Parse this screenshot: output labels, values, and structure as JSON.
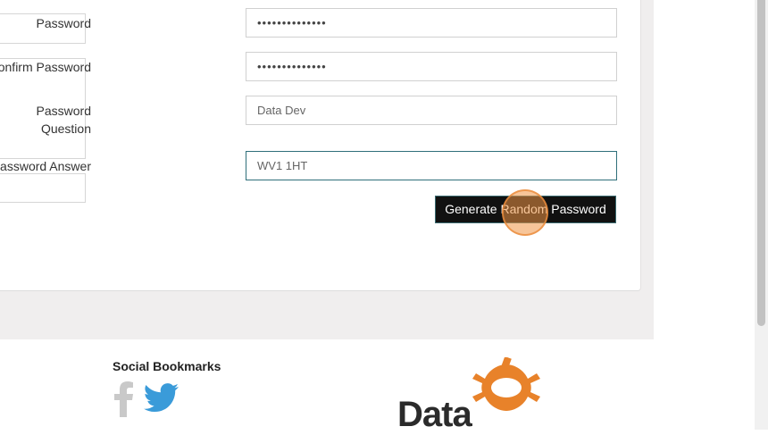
{
  "form": {
    "password": {
      "label": "Password",
      "value": "••••••••••••••"
    },
    "confirm_password": {
      "label": "Confirm Password",
      "value": "••••••••••••••"
    },
    "password_question": {
      "label": "Password Question",
      "value": "Data Dev"
    },
    "password_answer": {
      "label": "Password Answer",
      "value": "WV1 1HT"
    },
    "generate_button": "Generate Random Password"
  },
  "footer": {
    "social_title": "Social Bookmarks",
    "logo_text": "Data",
    "icons": [
      "facebook-icon",
      "twitter-icon"
    ]
  },
  "colors": {
    "button_bg": "#111111",
    "logo_orange": "#e8822a",
    "twitter_blue": "#3a9bd9",
    "focus_border": "#2f6f7a"
  }
}
